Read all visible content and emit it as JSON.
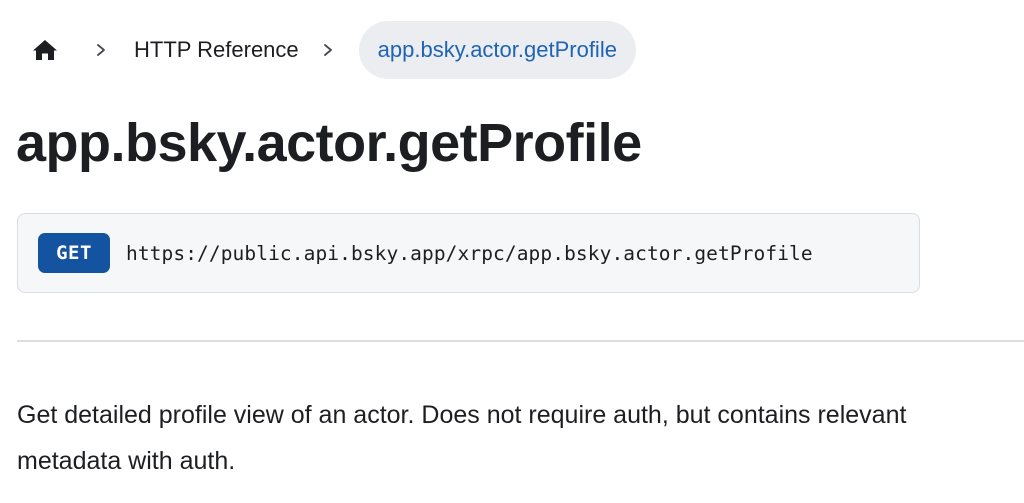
{
  "breadcrumb": {
    "home_icon": "home-icon",
    "separator_icon": "chevron-right-icon",
    "items": [
      {
        "label": "HTTP Reference"
      },
      {
        "label": "app.bsky.actor.getProfile"
      }
    ]
  },
  "page": {
    "title": "app.bsky.actor.getProfile"
  },
  "endpoint": {
    "method": "GET",
    "url": "https://public.api.bsky.app/xrpc/app.bsky.actor.getProfile"
  },
  "description": "Get detailed profile view of an actor. Does not require auth, but contains relevant metadata with auth.",
  "colors": {
    "accent": "#1e64b4",
    "method_badge": "#14539f",
    "active_crumb_bg": "#ebedf0",
    "code_box_bg": "#f6f7f8"
  }
}
